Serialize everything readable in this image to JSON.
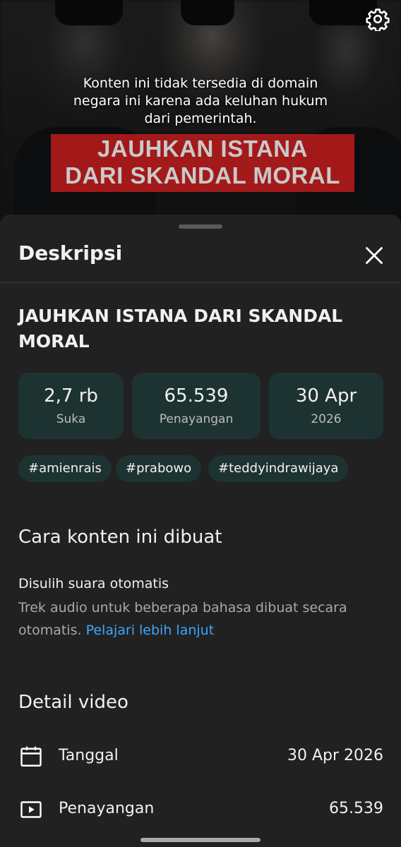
{
  "player": {
    "notice_lines": [
      "Konten ini tidak tersedia di domain",
      "negara ini karena ada keluhan hukum",
      "dari pemerintah."
    ],
    "thumbnail_text_lines": [
      "JAUHKAN ISTANA",
      "DARI SKANDAL MORAL"
    ],
    "settings_icon": "gear-icon"
  },
  "sheet": {
    "title": "Deskripsi",
    "close_icon": "close-icon",
    "video_title": "JAUHKAN ISTANA DARI SKANDAL MORAL",
    "stats": [
      {
        "value": "2,7 rb",
        "label": "Suka"
      },
      {
        "value": "65.539",
        "label": "Penayangan"
      },
      {
        "value": "30 Apr",
        "label": "2026"
      }
    ],
    "hashtags": [
      "#amienrais",
      "#prabowo",
      "#teddyindrawijaya"
    ],
    "content_made": {
      "heading": "Cara konten ini dibuat",
      "item_title": "Disulih suara otomatis",
      "item_desc": "Trek audio untuk beberapa bahasa dibuat secara otomatis.",
      "link": "Pelajari lebih lanjut"
    },
    "details": {
      "heading": "Detail video",
      "rows": [
        {
          "icon": "calendar-icon",
          "label": "Tanggal",
          "value": "30 Apr 2026"
        },
        {
          "icon": "play-icon",
          "label": "Penayangan",
          "value": "65.539"
        }
      ]
    }
  },
  "colors": {
    "sheet_bg": "#212121",
    "chip_bg": "#1d3331",
    "link": "#3ea6ff",
    "banner_red": "#b01b1b"
  }
}
